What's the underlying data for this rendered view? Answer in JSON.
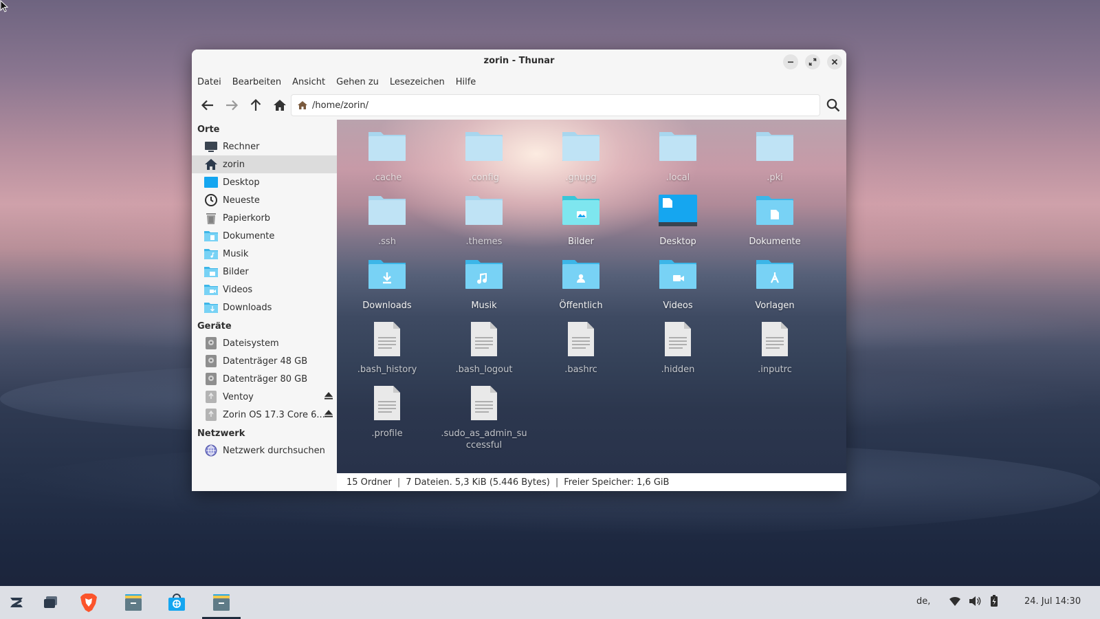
{
  "window": {
    "title": "zorin - Thunar",
    "menu": [
      "Datei",
      "Bearbeiten",
      "Ansicht",
      "Gehen zu",
      "Lesezeichen",
      "Hilfe"
    ],
    "path": "/home/zorin/"
  },
  "sidebar": {
    "sections": [
      {
        "title": "Orte",
        "items": [
          {
            "label": "Rechner",
            "icon": "computer-icon"
          },
          {
            "label": "zorin",
            "icon": "home-icon",
            "active": true
          },
          {
            "label": "Desktop",
            "icon": "desktop-icon"
          },
          {
            "label": "Neueste",
            "icon": "clock-icon"
          },
          {
            "label": "Papierkorb",
            "icon": "trash-icon"
          },
          {
            "label": "Dokumente",
            "icon": "folder-documents-icon"
          },
          {
            "label": "Musik",
            "icon": "folder-music-icon"
          },
          {
            "label": "Bilder",
            "icon": "folder-pictures-icon"
          },
          {
            "label": "Videos",
            "icon": "folder-videos-icon"
          },
          {
            "label": "Downloads",
            "icon": "folder-downloads-icon"
          }
        ]
      },
      {
        "title": "Geräte",
        "items": [
          {
            "label": "Dateisystem",
            "icon": "drive-icon"
          },
          {
            "label": "Datenträger 48 GB",
            "icon": "drive-icon"
          },
          {
            "label": "Datenträger 80 GB",
            "icon": "drive-icon"
          },
          {
            "label": "Ventoy",
            "icon": "usb-drive-icon",
            "eject": true
          },
          {
            "label": "Zorin OS 17.3 Core 6...",
            "icon": "usb-drive-icon",
            "eject": true
          }
        ]
      },
      {
        "title": "Netzwerk",
        "items": [
          {
            "label": "Netzwerk durchsuchen",
            "icon": "network-icon"
          }
        ]
      }
    ]
  },
  "files": [
    {
      "name": ".cache",
      "kind": "folder",
      "hidden": true
    },
    {
      "name": ".config",
      "kind": "folder",
      "hidden": true
    },
    {
      "name": ".gnupg",
      "kind": "folder",
      "hidden": true
    },
    {
      "name": ".local",
      "kind": "folder",
      "hidden": true
    },
    {
      "name": ".pki",
      "kind": "folder",
      "hidden": true
    },
    {
      "name": ".ssh",
      "kind": "folder",
      "hidden": true
    },
    {
      "name": ".themes",
      "kind": "folder",
      "hidden": true
    },
    {
      "name": "Bilder",
      "kind": "folder-pictures"
    },
    {
      "name": "Desktop",
      "kind": "desktop"
    },
    {
      "name": "Dokumente",
      "kind": "folder-documents"
    },
    {
      "name": "Downloads",
      "kind": "folder-downloads"
    },
    {
      "name": "Musik",
      "kind": "folder-music"
    },
    {
      "name": "Öffentlich",
      "kind": "folder-public"
    },
    {
      "name": "Videos",
      "kind": "folder-videos"
    },
    {
      "name": "Vorlagen",
      "kind": "folder-templates"
    },
    {
      "name": ".bash_history",
      "kind": "text-file",
      "hidden": true
    },
    {
      "name": ".bash_logout",
      "kind": "text-file",
      "hidden": true
    },
    {
      "name": ".bashrc",
      "kind": "text-file",
      "hidden": true
    },
    {
      "name": ".hidden",
      "kind": "text-file",
      "hidden": true
    },
    {
      "name": ".inputrc",
      "kind": "text-file",
      "hidden": true
    },
    {
      "name": ".profile",
      "kind": "text-file",
      "hidden": true
    },
    {
      "name": ".sudo_as_admin_successful",
      "kind": "text-file",
      "hidden": true
    }
  ],
  "status": {
    "folders": "15 Ordner",
    "files": "7 Dateien. 5,3 KiB (5.446 Bytes)",
    "free": "Freier Speicher: 1,6 GiB"
  },
  "taskbar": {
    "apps": [
      "zorin-menu-icon",
      "workspaces-icon",
      "brave-browser-icon",
      "file-manager-icon",
      "software-store-icon",
      "file-manager-active-icon"
    ],
    "keyboard_layout": "de,",
    "clock": "24. Jul 14:30"
  },
  "colors": {
    "folder_light": "#bfe3f5",
    "folder_dark": "#8fcdec",
    "folder_xdg": "#5ec8f0",
    "accent": "#15a6f0"
  }
}
